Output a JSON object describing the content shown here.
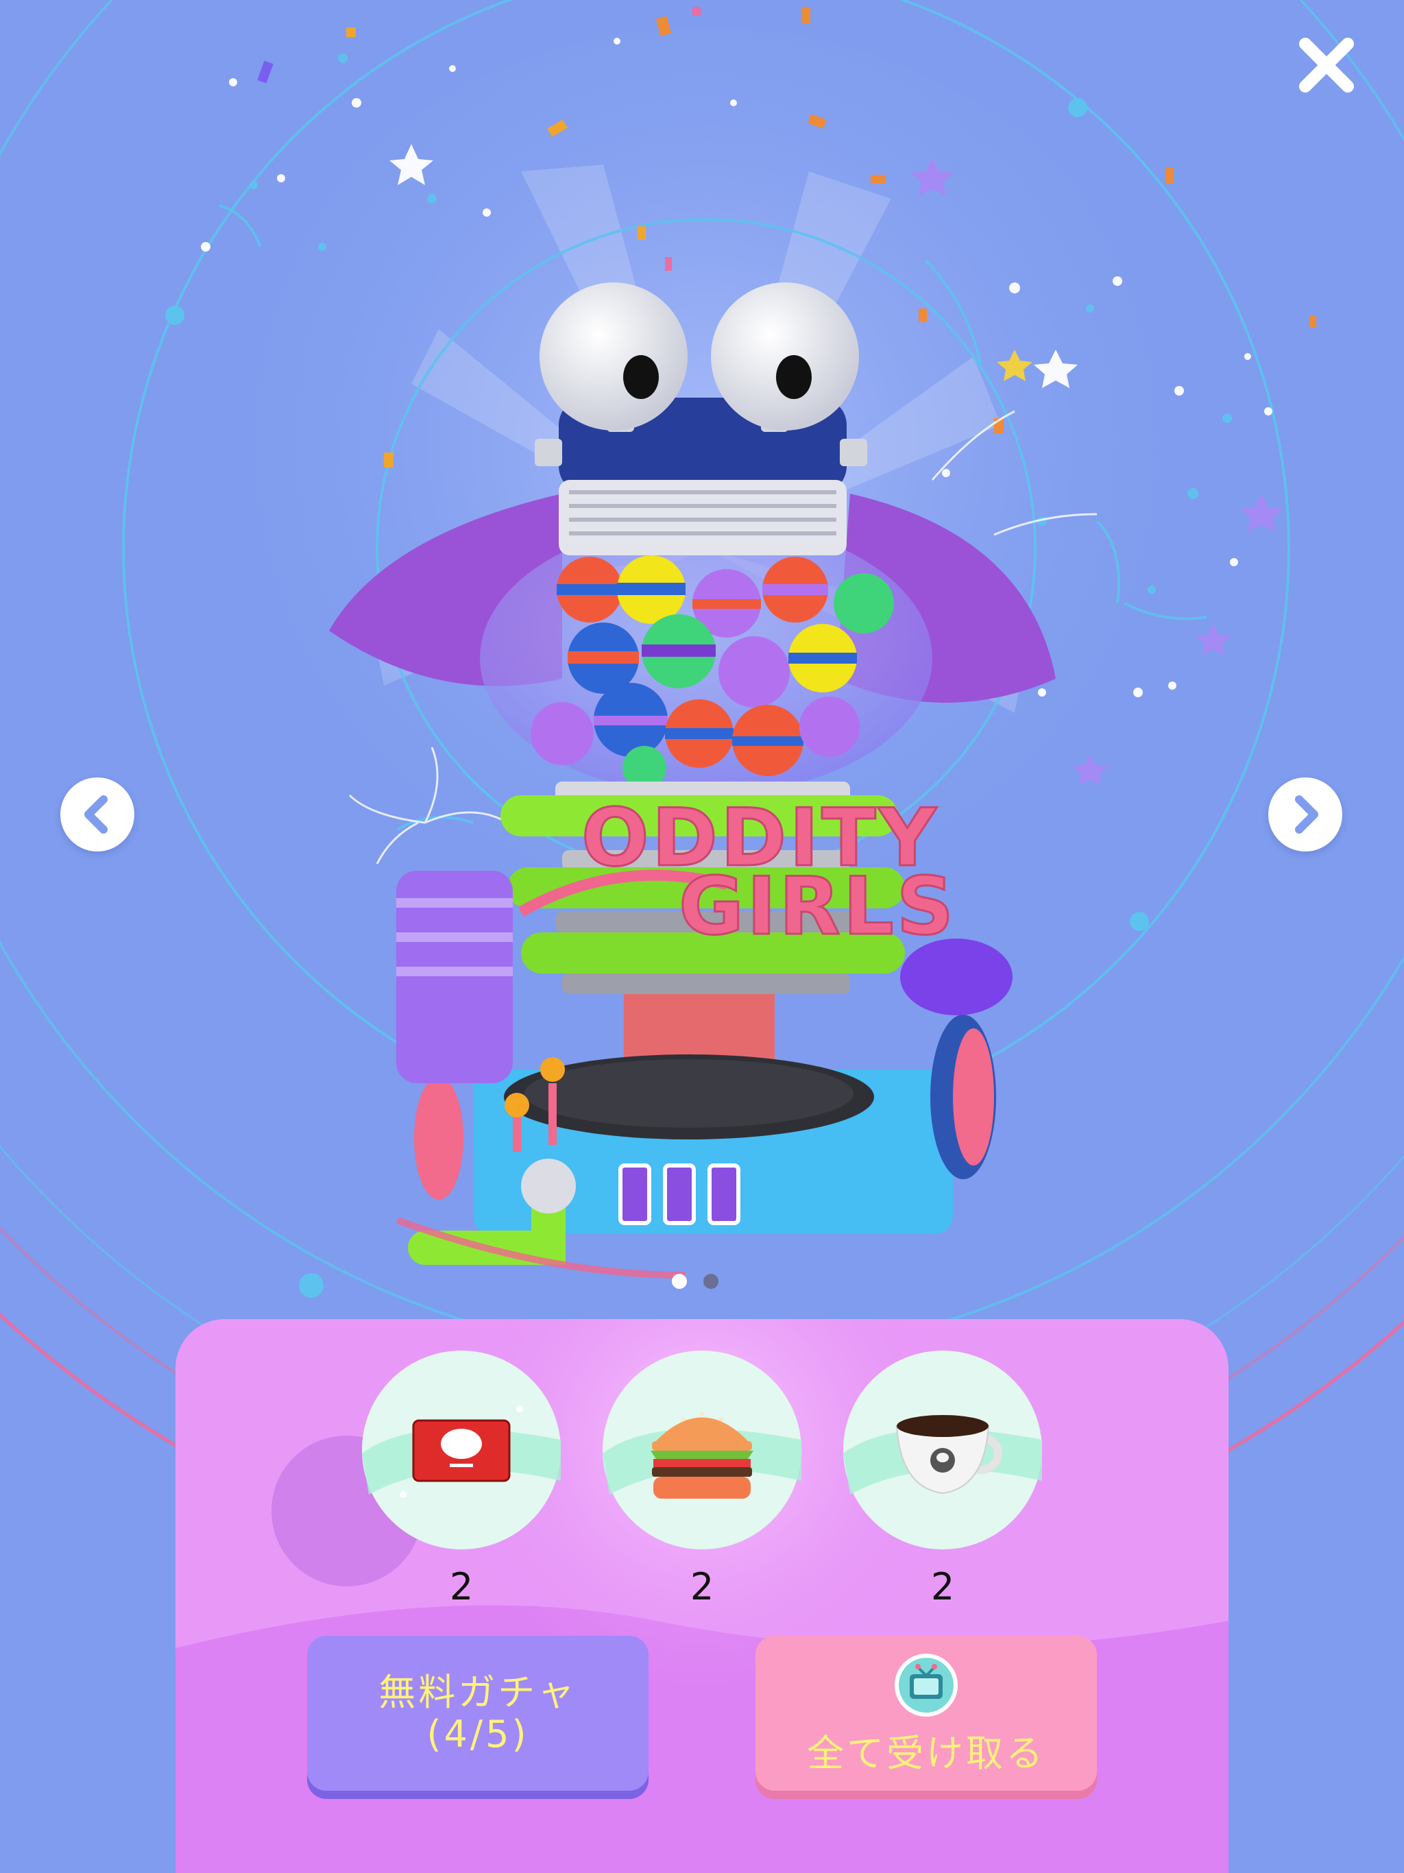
{
  "machine": {
    "logo_line1": "ODDITY",
    "logo_line2": "GIRLS"
  },
  "carousel": {
    "active_index": 1,
    "total": 2
  },
  "icons": {
    "close": "close-icon",
    "prev": "chevron-left-icon",
    "next": "chevron-right-icon",
    "item1": "gift-card-icon",
    "item2": "hamburger-icon",
    "item3": "coffee-cup-icon",
    "ad": "tv-icon"
  },
  "rewards": [
    {
      "name": "gift-card",
      "count": "2"
    },
    {
      "name": "hamburger",
      "count": "2"
    },
    {
      "name": "coffee",
      "count": "2"
    }
  ],
  "buttons": {
    "gacha_line1": "無料ガチャ",
    "gacha_line2": "(4/5)",
    "claim_label": "全て受け取る"
  },
  "colors": {
    "background": "#7f9cee",
    "panel": "#e08cf6",
    "gacha_button": "#a08af8",
    "claim_button": "#fb9cc4",
    "button_text": "#fff27a",
    "logo": "#f0668e"
  }
}
